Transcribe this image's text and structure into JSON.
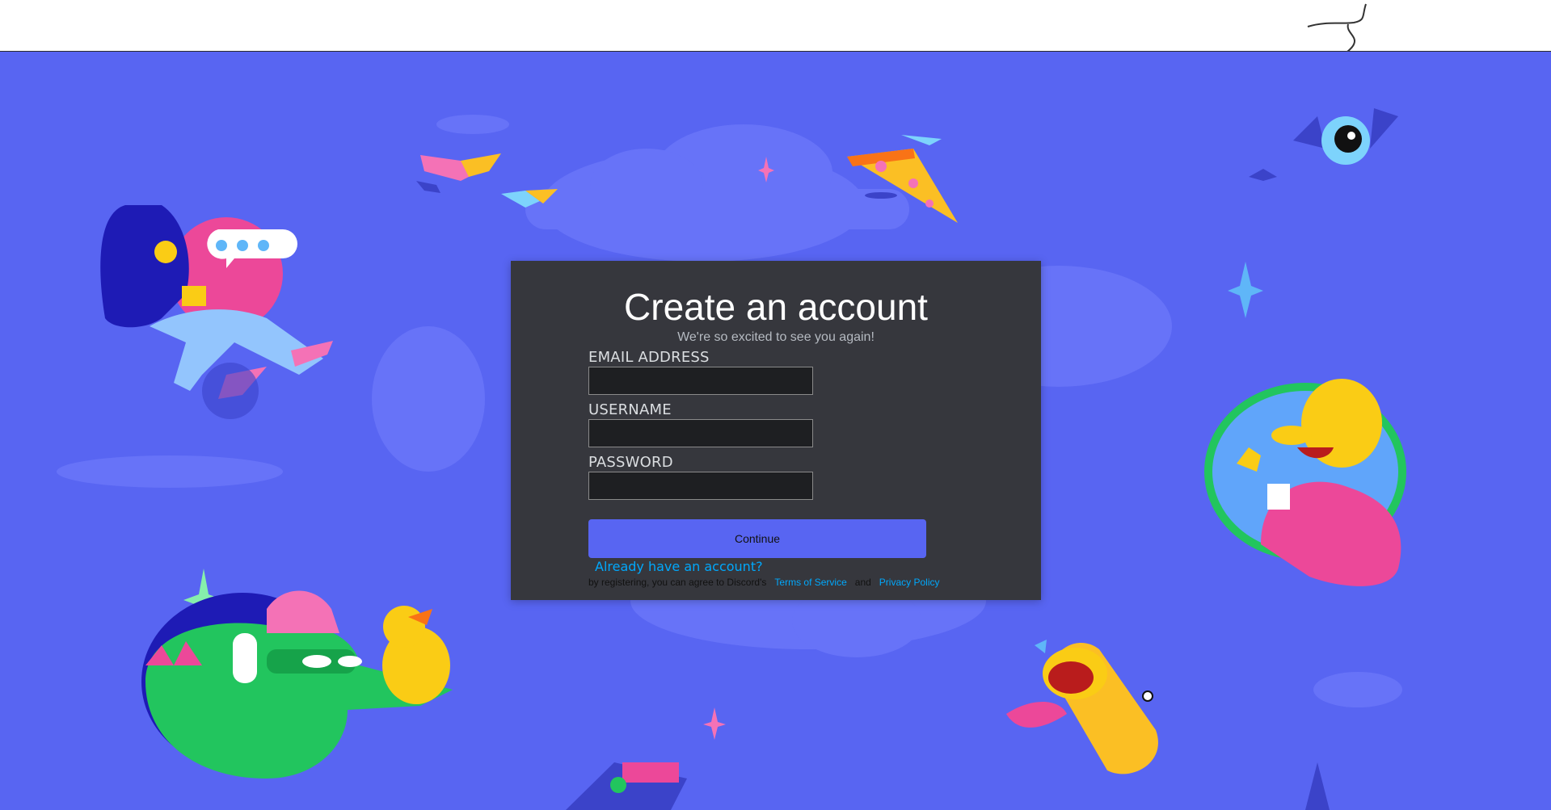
{
  "page": {
    "title": "Create an account",
    "subtitle": "We're so excited to see you again!"
  },
  "form": {
    "email": {
      "label": "EMAIL ADDRESS",
      "value": "",
      "placeholder": ""
    },
    "username": {
      "label": "USERNAME",
      "value": "",
      "placeholder": ""
    },
    "password": {
      "label": "PASSWORD",
      "value": "",
      "placeholder": ""
    },
    "continue_label": "Continue"
  },
  "links": {
    "login": "Already have an account?",
    "legal_prefix": "by registering, you can agree to Discord's",
    "terms": "Terms of Service",
    "and": "and",
    "privacy": "Privacy Policy"
  },
  "colors": {
    "background": "#5865f2",
    "panel": "#36373d",
    "input": "#1e1f22",
    "link": "#00a8fc",
    "button": "#5865f2"
  },
  "decor": {
    "icons": [
      "pen-scribble",
      "sparkle",
      "cloud",
      "pizza-slice",
      "book",
      "character-on-couch",
      "character-with-mug",
      "dinosaur-with-headphones",
      "horn",
      "bat",
      "duck"
    ]
  }
}
